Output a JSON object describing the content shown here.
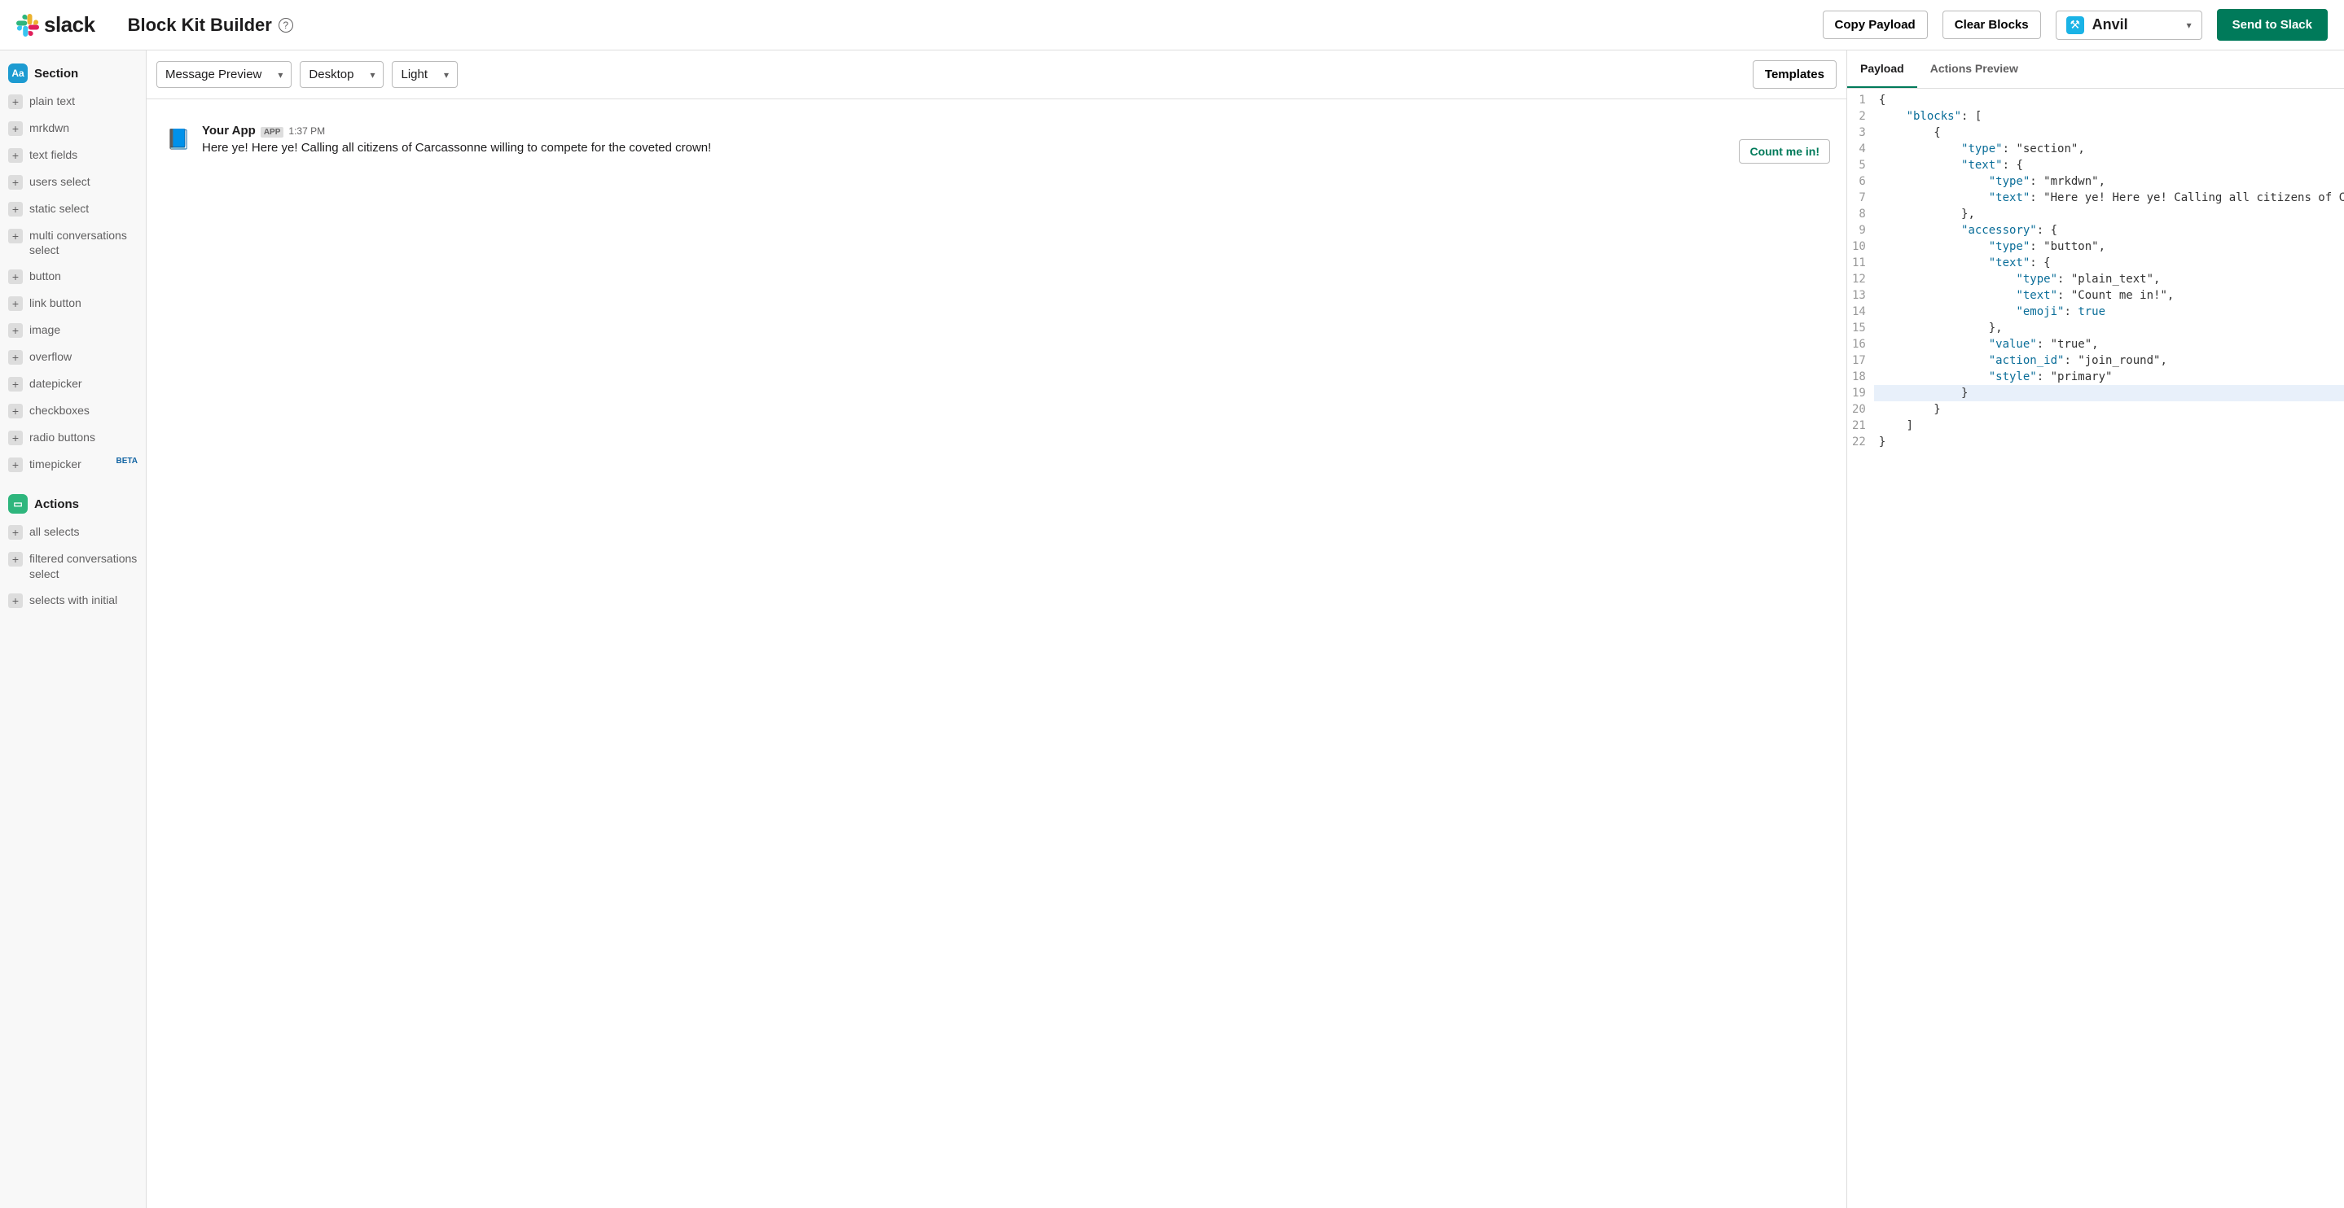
{
  "header": {
    "brand": "slack",
    "title": "Block Kit Builder",
    "copy_payload": "Copy Payload",
    "clear_blocks": "Clear Blocks",
    "workspace": "Anvil",
    "send": "Send to Slack"
  },
  "sidebar": {
    "section_group": "Section",
    "section_items": [
      "plain text",
      "mrkdwn",
      "text fields",
      "users select",
      "static select",
      "multi conversations select",
      "button",
      "link button",
      "image",
      "overflow",
      "datepicker",
      "checkboxes",
      "radio buttons",
      "timepicker"
    ],
    "beta_label": "BETA",
    "actions_group": "Actions",
    "actions_items": [
      "all selects",
      "filtered conversations select",
      "selects with initial"
    ]
  },
  "preview": {
    "mode": "Message Preview",
    "surface": "Desktop",
    "theme": "Light",
    "templates": "Templates",
    "app_name": "Your App",
    "app_tag": "APP",
    "timestamp": "1:37 PM",
    "message_text": "Here ye! Here ye! Calling all citizens of Carcassonne willing to compete for the coveted crown!",
    "accessory_button": "Count me in!"
  },
  "code_panel": {
    "tab_payload": "Payload",
    "tab_actions": "Actions Preview",
    "highlight_line": 19,
    "code": [
      [
        [
          "punc",
          "{"
        ]
      ],
      [
        [
          "ind",
          "    "
        ],
        [
          "key",
          "\"blocks\""
        ],
        [
          "punc",
          ": ["
        ]
      ],
      [
        [
          "ind",
          "        "
        ],
        [
          "punc",
          "{"
        ]
      ],
      [
        [
          "ind",
          "            "
        ],
        [
          "key",
          "\"type\""
        ],
        [
          "punc",
          ": "
        ],
        [
          "str",
          "\"section\""
        ],
        [
          "punc",
          ","
        ]
      ],
      [
        [
          "ind",
          "            "
        ],
        [
          "key",
          "\"text\""
        ],
        [
          "punc",
          ": {"
        ]
      ],
      [
        [
          "ind",
          "                "
        ],
        [
          "key",
          "\"type\""
        ],
        [
          "punc",
          ": "
        ],
        [
          "str",
          "\"mrkdwn\""
        ],
        [
          "punc",
          ","
        ]
      ],
      [
        [
          "ind",
          "                "
        ],
        [
          "key",
          "\"text\""
        ],
        [
          "punc",
          ": "
        ],
        [
          "str",
          "\"Here ye! Here ye! Calling all citizens of Carcassonne willing to compete for the coveted crown! \""
        ]
      ],
      [
        [
          "ind",
          "            "
        ],
        [
          "punc",
          "},"
        ]
      ],
      [
        [
          "ind",
          "            "
        ],
        [
          "key",
          "\"accessory\""
        ],
        [
          "punc",
          ": {"
        ]
      ],
      [
        [
          "ind",
          "                "
        ],
        [
          "key",
          "\"type\""
        ],
        [
          "punc",
          ": "
        ],
        [
          "str",
          "\"button\""
        ],
        [
          "punc",
          ","
        ]
      ],
      [
        [
          "ind",
          "                "
        ],
        [
          "key",
          "\"text\""
        ],
        [
          "punc",
          ": {"
        ]
      ],
      [
        [
          "ind",
          "                    "
        ],
        [
          "key",
          "\"type\""
        ],
        [
          "punc",
          ": "
        ],
        [
          "str",
          "\"plain_text\""
        ],
        [
          "punc",
          ","
        ]
      ],
      [
        [
          "ind",
          "                    "
        ],
        [
          "key",
          "\"text\""
        ],
        [
          "punc",
          ": "
        ],
        [
          "str",
          "\"Count me in!\""
        ],
        [
          "punc",
          ","
        ]
      ],
      [
        [
          "ind",
          "                    "
        ],
        [
          "key",
          "\"emoji\""
        ],
        [
          "punc",
          ": "
        ],
        [
          "bool",
          "true"
        ]
      ],
      [
        [
          "ind",
          "                "
        ],
        [
          "punc",
          "},"
        ]
      ],
      [
        [
          "ind",
          "                "
        ],
        [
          "key",
          "\"value\""
        ],
        [
          "punc",
          ": "
        ],
        [
          "str",
          "\"true\""
        ],
        [
          "punc",
          ","
        ]
      ],
      [
        [
          "ind",
          "                "
        ],
        [
          "key",
          "\"action_id\""
        ],
        [
          "punc",
          ": "
        ],
        [
          "str",
          "\"join_round\""
        ],
        [
          "punc",
          ","
        ]
      ],
      [
        [
          "ind",
          "                "
        ],
        [
          "key",
          "\"style\""
        ],
        [
          "punc",
          ": "
        ],
        [
          "str",
          "\"primary\""
        ]
      ],
      [
        [
          "ind",
          "            "
        ],
        [
          "punc",
          "}"
        ]
      ],
      [
        [
          "ind",
          "        "
        ],
        [
          "punc",
          "}"
        ]
      ],
      [
        [
          "ind",
          "    "
        ],
        [
          "punc",
          "]"
        ]
      ],
      [
        [
          "punc",
          "}"
        ]
      ]
    ]
  }
}
